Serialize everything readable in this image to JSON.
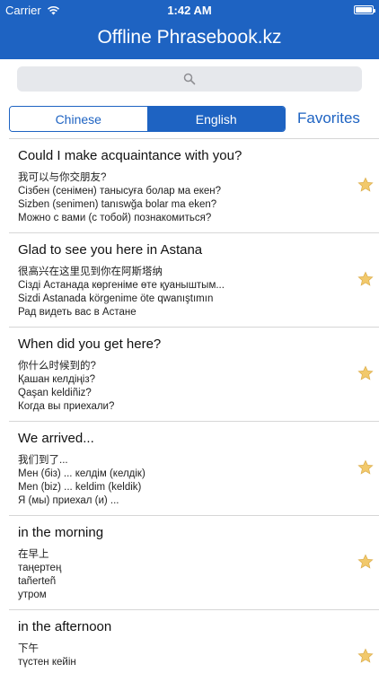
{
  "status_bar": {
    "carrier": "Carrier",
    "time": "1:42 AM"
  },
  "app": {
    "title": "Offline Phrasebook.kz"
  },
  "search": {
    "placeholder": ""
  },
  "segments": [
    {
      "label": "Chinese",
      "selected": false
    },
    {
      "label": "English",
      "selected": true
    }
  ],
  "favorites_label": "Favorites",
  "colors": {
    "accent": "#1e63c2",
    "star": "#f2c96b"
  },
  "phrases": [
    {
      "title": "Could I make acquaintance with you?",
      "zh": "我可以与你交朋友?",
      "kk_cyr": "Сізбен (сенімен) танысуға болар ма екен?",
      "kk_lat": "Sizben (senimen) tanıswğa bolar ma eken?",
      "ru": "Можно с вами (с тобой) познакомиться?",
      "icon": "star-icon"
    },
    {
      "title": "Glad to see you here in Astana",
      "zh": "很高兴在这里见到你在阿斯塔纳",
      "kk_cyr": "Сізді Астанада көргеніме өте қуаныштым...",
      "kk_lat": "Sizdi Astanada körgenime öte qwanıştımın",
      "ru": "Рад видеть вас в Астане",
      "icon": "star-icon"
    },
    {
      "title": "When did you get here?",
      "zh": "你什么时候到的?",
      "kk_cyr": "Қашан келдіңіз?",
      "kk_lat": "Qaşan keldiñiz?",
      "ru": "Когда вы приехали?",
      "icon": "star-icon"
    },
    {
      "title": "We arrived...",
      "zh": "我们到了...",
      "kk_cyr": "Мен (біз) ... келдім (келдік)",
      "kk_lat": "Men (biz) ... keldim (keldik)",
      "ru": "Я (мы) приехал (и) ...",
      "icon": "star-icon"
    },
    {
      "title": "in the morning",
      "zh": "在早上",
      "kk_cyr": "таңертең",
      "kk_lat": "tañerteñ",
      "ru": "утром",
      "icon": "star-icon"
    },
    {
      "title": "in the afternoon",
      "zh": "下午",
      "kk_cyr": "түстен кейін",
      "kk_lat": "",
      "ru": "",
      "icon": "star-icon"
    }
  ]
}
